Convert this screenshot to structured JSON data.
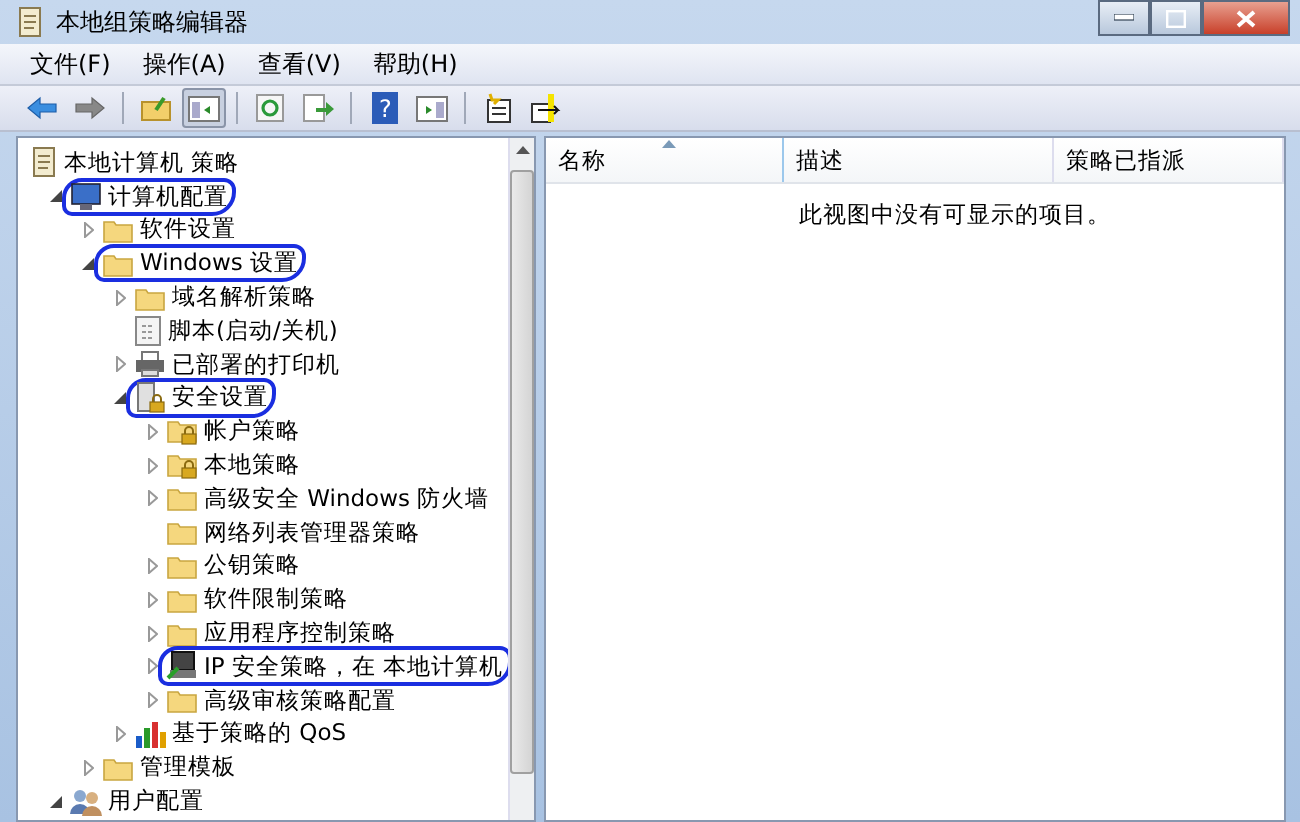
{
  "window": {
    "title": "本地组策略编辑器"
  },
  "menu": [
    "文件(F)",
    "操作(A)",
    "查看(V)",
    "帮助(H)"
  ],
  "toolbar": [
    {
      "kind": "back",
      "pressed": false
    },
    {
      "kind": "forward",
      "pressed": false
    },
    {
      "kind": "sep"
    },
    {
      "kind": "up",
      "pressed": false
    },
    {
      "kind": "tree",
      "pressed": true
    },
    {
      "kind": "sep"
    },
    {
      "kind": "refresh",
      "pressed": false
    },
    {
      "kind": "export",
      "pressed": false
    },
    {
      "kind": "sep"
    },
    {
      "kind": "help",
      "glyph": "?",
      "pressed": false
    },
    {
      "kind": "pane",
      "pressed": false
    },
    {
      "kind": "sep"
    },
    {
      "kind": "newdoc",
      "pressed": false
    },
    {
      "kind": "import",
      "pressed": false
    }
  ],
  "tree": [
    {
      "label": "本地计算机 策略",
      "kind": "policy",
      "children": [
        {
          "label": "计算机配置",
          "kind": "computer",
          "expanded": true,
          "annotated": true,
          "children": [
            {
              "label": "软件设置",
              "kind": "folder",
              "expanded": false
            },
            {
              "label": "Windows 设置",
              "kind": "folder",
              "expanded": true,
              "annotated": true,
              "children": [
                {
                  "label": "域名解析策略",
                  "kind": "folder",
                  "expanded": false
                },
                {
                  "label": "脚本(启动/关机)",
                  "kind": "script"
                },
                {
                  "label": "已部署的打印机",
                  "kind": "printer",
                  "expanded": false
                },
                {
                  "label": "安全设置",
                  "kind": "security",
                  "expanded": true,
                  "annotated": true,
                  "children": [
                    {
                      "label": "帐户策略",
                      "kind": "lockfolder",
                      "expanded": false
                    },
                    {
                      "label": "本地策略",
                      "kind": "lockfolder",
                      "expanded": false
                    },
                    {
                      "label": "高级安全 Windows 防火墙",
                      "kind": "folder",
                      "expanded": false
                    },
                    {
                      "label": "网络列表管理器策略",
                      "kind": "folder"
                    },
                    {
                      "label": "公钥策略",
                      "kind": "folder",
                      "expanded": false
                    },
                    {
                      "label": "软件限制策略",
                      "kind": "folder",
                      "expanded": false
                    },
                    {
                      "label": "应用程序控制策略",
                      "kind": "folder",
                      "expanded": false
                    },
                    {
                      "label": "IP 安全策略，在 本地计算机",
                      "kind": "ip",
                      "expanded": false,
                      "annotated": true
                    },
                    {
                      "label": "高级审核策略配置",
                      "kind": "folder",
                      "expanded": false
                    }
                  ]
                },
                {
                  "label": "基于策略的 QoS",
                  "kind": "qos",
                  "expanded": false
                }
              ]
            },
            {
              "label": "管理模板",
              "kind": "folder",
              "expanded": false
            }
          ]
        },
        {
          "label": "用户配置",
          "kind": "user",
          "expanded": true
        }
      ]
    }
  ],
  "list": {
    "columns": [
      "名称",
      "描述",
      "策略已指派"
    ],
    "empty_message": "此视图中没有可显示的项目。"
  }
}
